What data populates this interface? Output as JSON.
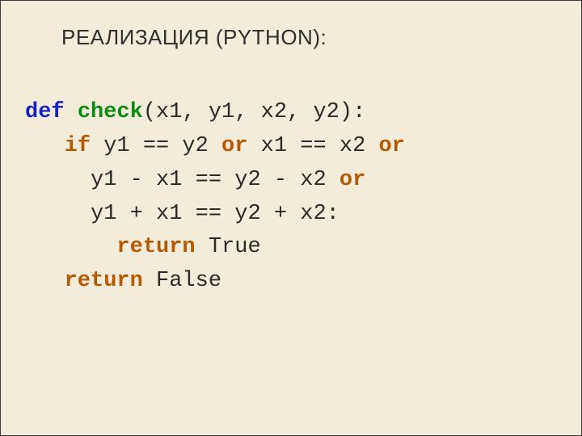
{
  "title": "РЕАЛИЗАЦИЯ (PYTHON):",
  "code": {
    "kw_def": "def",
    "fn_name": "check",
    "sig_rest": "(x1, y1, x2, y2):",
    "kw_if": "if",
    "kw_or": "or",
    "cond1_a": " y1 == y2 ",
    "cond1_b": " x1 == x2 ",
    "cond2_a": "     y1 - x1 == y2 - x2 ",
    "cond3_a": "     y1 + x1 == y2 + x2:",
    "kw_return": "return",
    "true_lit": " True",
    "false_lit": " False",
    "indent1": "   ",
    "indent2": "       "
  }
}
